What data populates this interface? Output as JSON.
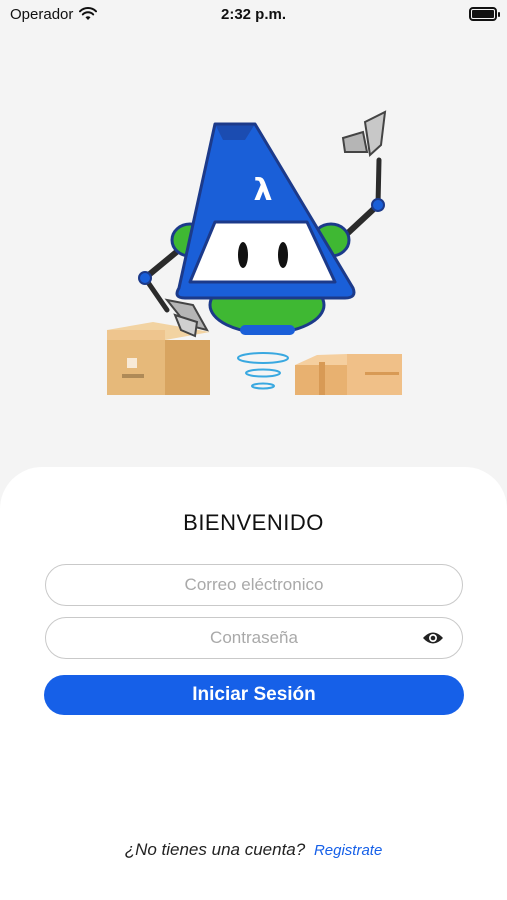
{
  "status_bar": {
    "carrier": "Operador",
    "time": "2:32 p.m.",
    "wifi_icon": "wifi-icon",
    "battery_icon": "battery-icon"
  },
  "illustration": {
    "robot_symbol": "λ",
    "icon": "robot-mascot-illustration",
    "colors": {
      "robot_blue": "#1a5fd8",
      "robot_green": "#3fb833",
      "box": "#e6b97a"
    }
  },
  "login": {
    "title": "BIENVENIDO",
    "email_placeholder": "Correo eléctronico",
    "password_placeholder": "Contraseña",
    "password_toggle_icon": "eye-icon",
    "submit_label": "Iniciar Sesión"
  },
  "footer": {
    "question": "¿No tienes una cuenta?",
    "register_link": "Registrate"
  },
  "colors": {
    "accent": "#1660e8",
    "background": "#f4f4f4",
    "card": "#ffffff"
  }
}
